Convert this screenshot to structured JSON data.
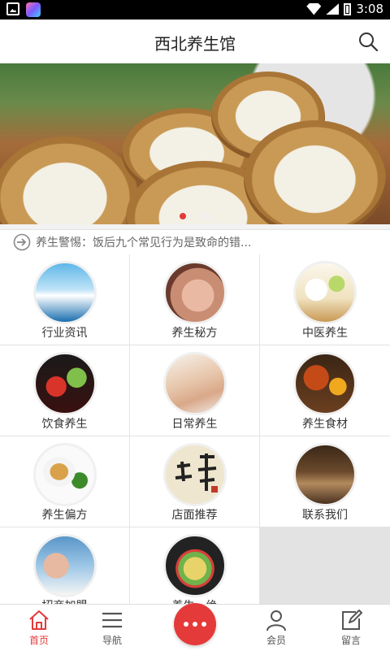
{
  "status_bar": {
    "time": "3:08"
  },
  "header": {
    "title": "西北养生馆"
  },
  "banner": {
    "slides": 2,
    "active": 1
  },
  "notice": {
    "text": "养生警惕：饭后九个常见行为是致命的错..."
  },
  "grid": {
    "items": [
      {
        "label": "行业资讯",
        "icon": "yoga-photo"
      },
      {
        "label": "养生秘方",
        "icon": "face-massage-photo"
      },
      {
        "label": "中医养生",
        "icon": "milk-fruit-photo"
      },
      {
        "label": "饮食养生",
        "icon": "tea-petals-photo"
      },
      {
        "label": "日常养生",
        "icon": "back-massage-photo"
      },
      {
        "label": "养生食材",
        "icon": "tea-honey-photo"
      },
      {
        "label": "养生偏方",
        "icon": "tea-cup-photo"
      },
      {
        "label": "店面推荐",
        "icon": "calligraphy-photo"
      },
      {
        "label": "联系我们",
        "icon": "spa-room-photo"
      },
      {
        "label": "招商加盟",
        "icon": "spa-woman-photo"
      },
      {
        "label": "养生一绝",
        "icon": "dish-photo"
      }
    ]
  },
  "nav": {
    "items": [
      {
        "label": "首页",
        "icon": "home-icon",
        "active": true
      },
      {
        "label": "导航",
        "icon": "menu-icon"
      },
      {
        "label": "",
        "icon": "more-icon"
      },
      {
        "label": "会员",
        "icon": "user-icon"
      },
      {
        "label": "留言",
        "icon": "edit-icon"
      }
    ]
  },
  "colors": {
    "accent": "#e53a3a",
    "divider": "#e3e3e3"
  }
}
